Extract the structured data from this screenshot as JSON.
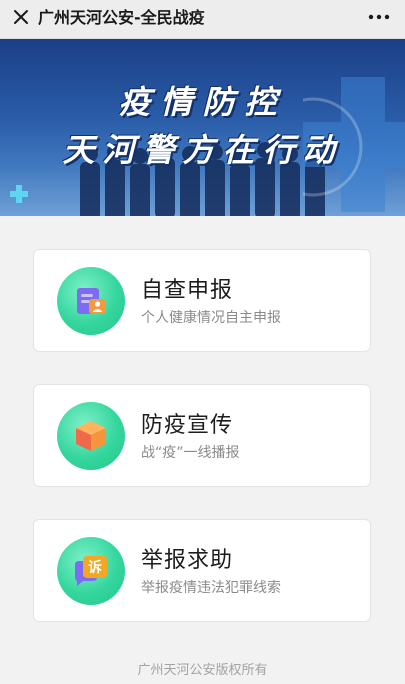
{
  "topbar": {
    "title": "广州天河公安-全民战疫",
    "close_icon": "close-icon",
    "more_icon": "more-dots-icon"
  },
  "banner": {
    "line1": "疫情防控",
    "line2": "天河警方在行动"
  },
  "cards": [
    {
      "title": "自查申报",
      "subtitle": "个人健康情况自主申报",
      "icon": "id-card-icon"
    },
    {
      "title": "防疫宣传",
      "subtitle": "战“疫”一线播报",
      "icon": "box-icon"
    },
    {
      "title": "举报求助",
      "subtitle": "举报疫情违法犯罪线索",
      "icon": "complaint-chat-icon",
      "icon_text": "诉"
    }
  ],
  "footer": "广州天河公安版权所有",
  "colors": {
    "accent_green": "#35d69e",
    "banner_blue": "#2a5ca8"
  }
}
